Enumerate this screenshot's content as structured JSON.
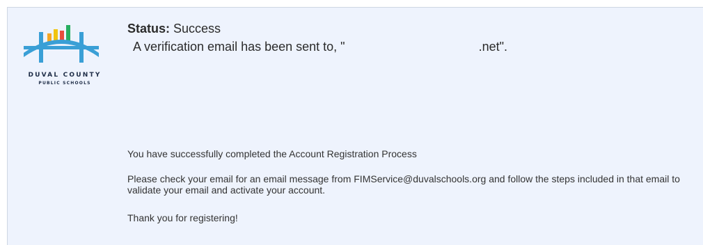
{
  "logo": {
    "line1": "DUVAL COUNTY",
    "line2": "PUBLIC SCHOOLS",
    "bar_colors": [
      "#f6a623",
      "#f1c40f",
      "#e74c3c",
      "#27ae60"
    ],
    "arch_color": "#3a9fd6"
  },
  "status": {
    "label": "Status:",
    "value": "Success"
  },
  "verification": {
    "prefix": "A verification email has been sent to, \"",
    "suffix": ".net\"."
  },
  "messages": {
    "completed": "You have successfully completed the Account Registration Process",
    "instructions": "Please check your email for an email message from FIMService@duvalschools.org and follow the steps included in that email to validate your email and activate your account.",
    "thanks": "Thank you for registering!"
  }
}
